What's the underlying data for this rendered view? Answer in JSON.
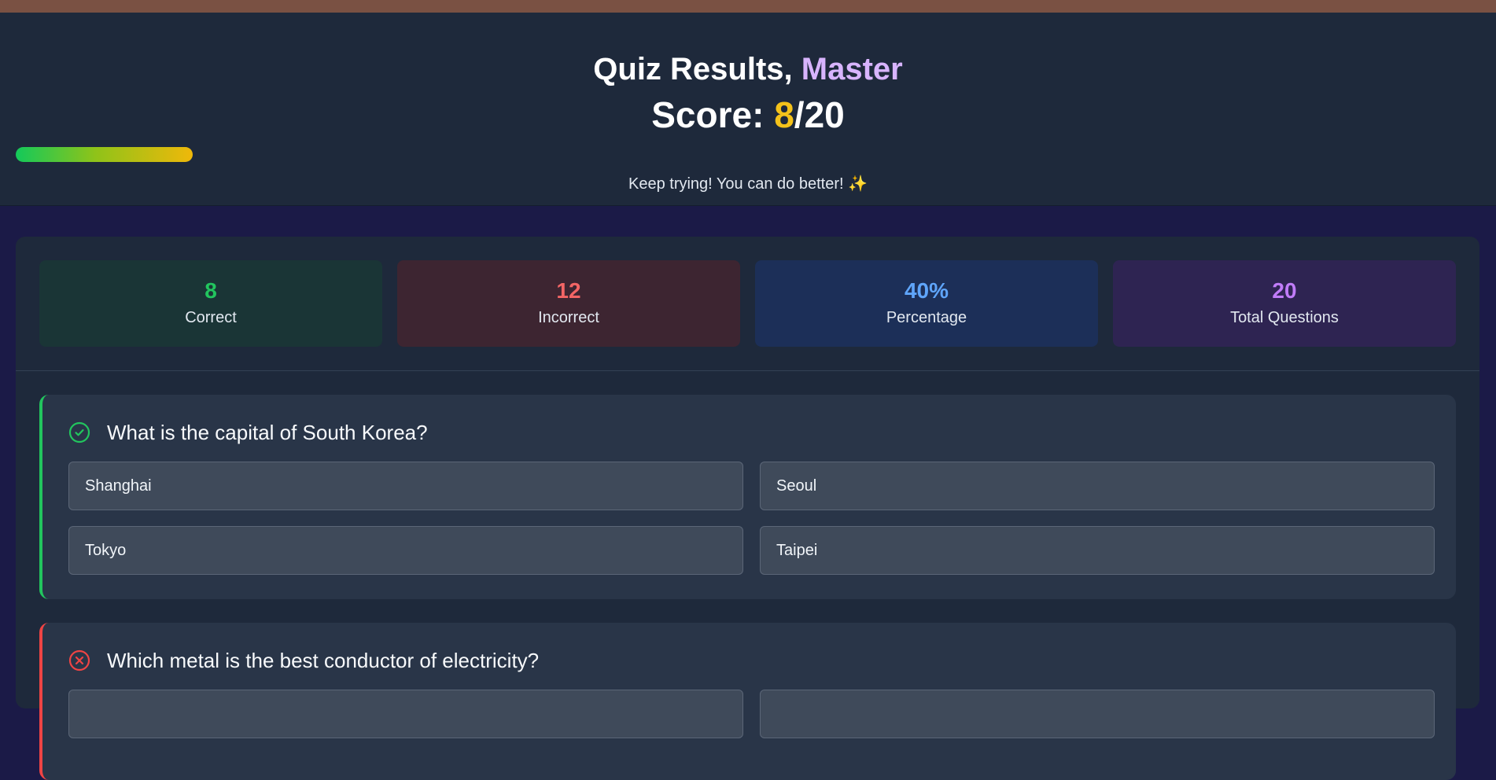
{
  "header": {
    "title_prefix": "Quiz Results, ",
    "user_name": "Master",
    "score_label": "Score: ",
    "score_correct": "8",
    "score_total": "/20",
    "message": "Keep trying! You can do better! ✨",
    "progress_fraction": 0.4
  },
  "stats": [
    {
      "value": "8",
      "label": "Correct"
    },
    {
      "value": "12",
      "label": "Incorrect"
    },
    {
      "value": "40%",
      "label": "Percentage"
    },
    {
      "value": "20",
      "label": "Total Questions"
    }
  ],
  "questions": [
    {
      "status": "correct",
      "status_icon": "check-circle-icon",
      "text": "What is the capital of South Korea?",
      "options": [
        "Shanghai",
        "Seoul",
        "Tokyo",
        "Taipei"
      ]
    },
    {
      "status": "incorrect",
      "status_icon": "x-circle-icon",
      "text": "Which metal is the best conductor of electricity?",
      "options": []
    }
  ],
  "colors": {
    "correct": "#22c55e",
    "incorrect": "#ef4444",
    "percentage": "#5fa5fa",
    "total": "#c07cf8",
    "score_highlight": "#f4c21a",
    "name_highlight": "#d8b4fe"
  }
}
